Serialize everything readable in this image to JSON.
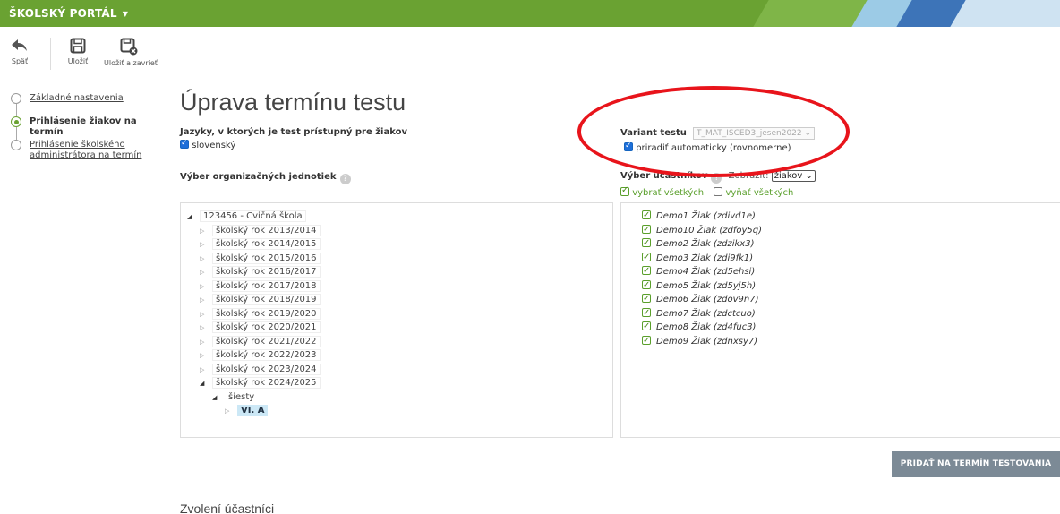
{
  "app": {
    "brand": "ŠKOLSKÝ PORTÁL"
  },
  "toolbar": {
    "back": "Späť",
    "save": "Uložiť",
    "save_close": "Uložiť a zavrieť"
  },
  "steps": [
    {
      "label": "Základné nastavenia"
    },
    {
      "label": "Prihlásenie žiakov na termín"
    },
    {
      "label": "Prihlásenie školského administrátora na termín"
    }
  ],
  "page_title": "Úprava termínu testu",
  "languages": {
    "label": "Jazyky, v ktorých je test prístupný pre žiakov",
    "option": "slovenský"
  },
  "org_units": {
    "label": "Výber organizačných jednotiek"
  },
  "variant": {
    "label": "Variant testu",
    "value": "T_MAT_ISCED3_jesen2022",
    "auto_label": "priradiť automaticky (rovnomerne)"
  },
  "participants": {
    "label": "Výber účastníkov",
    "show_label": "Zobraziť:",
    "show_value": "žiakov",
    "select_all": "vybrať všetkých",
    "deselect_all": "vyňať všetkých",
    "items": [
      "Demo1 Žiak (zdivd1e)",
      "Demo10 Žiak (zdfoy5q)",
      "Demo2 Žiak (zdzikx3)",
      "Demo3 Žiak (zdi9fk1)",
      "Demo4 Žiak (zd5ehsi)",
      "Demo5 Žiak (zd5yj5h)",
      "Demo6 Žiak (zdov9n7)",
      "Demo7 Žiak (zdctcuo)",
      "Demo8 Žiak (zd4fuc3)",
      "Demo9 Žiak (zdnxsy7)"
    ]
  },
  "tree": {
    "root": "123456 - Cvičná škola",
    "years": [
      "školský rok 2013/2014",
      "školský rok 2014/2015",
      "školský rok 2015/2016",
      "školský rok 2016/2017",
      "školský rok 2017/2018",
      "školský rok 2018/2019",
      "školský rok 2019/2020",
      "školský rok 2020/2021",
      "školský rok 2021/2022",
      "školský rok 2022/2023",
      "školský rok 2023/2024",
      "školský rok 2024/2025"
    ],
    "grade": "šiesty",
    "class": "VI. A"
  },
  "add_button": "PRIDAŤ NA TERMÍN TESTOVANIA",
  "selected_heading": "Zvolení účastníci"
}
